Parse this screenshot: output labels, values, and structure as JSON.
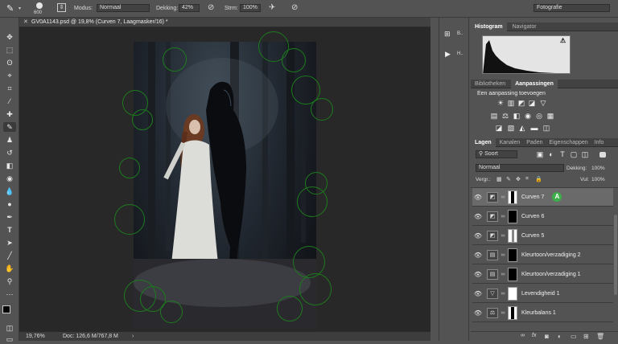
{
  "options_bar": {
    "brush_size": "600",
    "mode_label": "Modus:",
    "mode_value": "Normaal",
    "opacity_label": "Dekking:",
    "opacity_value": "42%",
    "flow_label": "Strm:",
    "flow_value": "100%",
    "workspace": "Fotografie"
  },
  "document": {
    "tab_title": "GV0A1143.psd @ 19,8% (Curven 7, Laagmasker/16) *",
    "zoom": "19,76%",
    "doc_size": "Doc: 126,6 M/767,8 M"
  },
  "dock": {
    "item1_label": "B..",
    "item2_label": "H.."
  },
  "histogram_panel": {
    "tabs": [
      "Histogram",
      "Navigator"
    ],
    "warning": "!"
  },
  "adjustments_panel": {
    "tabs": [
      "Bibliotheken",
      "Aanpassingen"
    ],
    "subtitle": "Een aanpassing toevoegen"
  },
  "layers_panel": {
    "tabs": [
      "Lagen",
      "Kanalen",
      "Paden",
      "Eigenschappen",
      "Info"
    ],
    "filter_label": "Soort",
    "blend_mode": "Normaal",
    "opacity_label": "Dekking:",
    "opacity_value": "100%",
    "lock_label": "Vergr.:",
    "fill_label": "Vul:",
    "fill_value": "100%",
    "badge": "A",
    "footer_fx": "fx",
    "layers": [
      {
        "name": "Curven 7",
        "selected": true
      },
      {
        "name": "Curven 6",
        "selected": false
      },
      {
        "name": "Curven 5",
        "selected": false
      },
      {
        "name": "Kleurtoon/verzadiging 2",
        "selected": false
      },
      {
        "name": "Kleurtoon/verzadiging 1",
        "selected": false
      },
      {
        "name": "Levendigheid 1",
        "selected": false
      },
      {
        "name": "Kleurbalans 1",
        "selected": false
      }
    ]
  },
  "colors": {
    "panel_bg": "#535353",
    "canvas_bg": "#282828",
    "brush_circle": "#1d7a1d",
    "badge": "#3cae4a"
  }
}
